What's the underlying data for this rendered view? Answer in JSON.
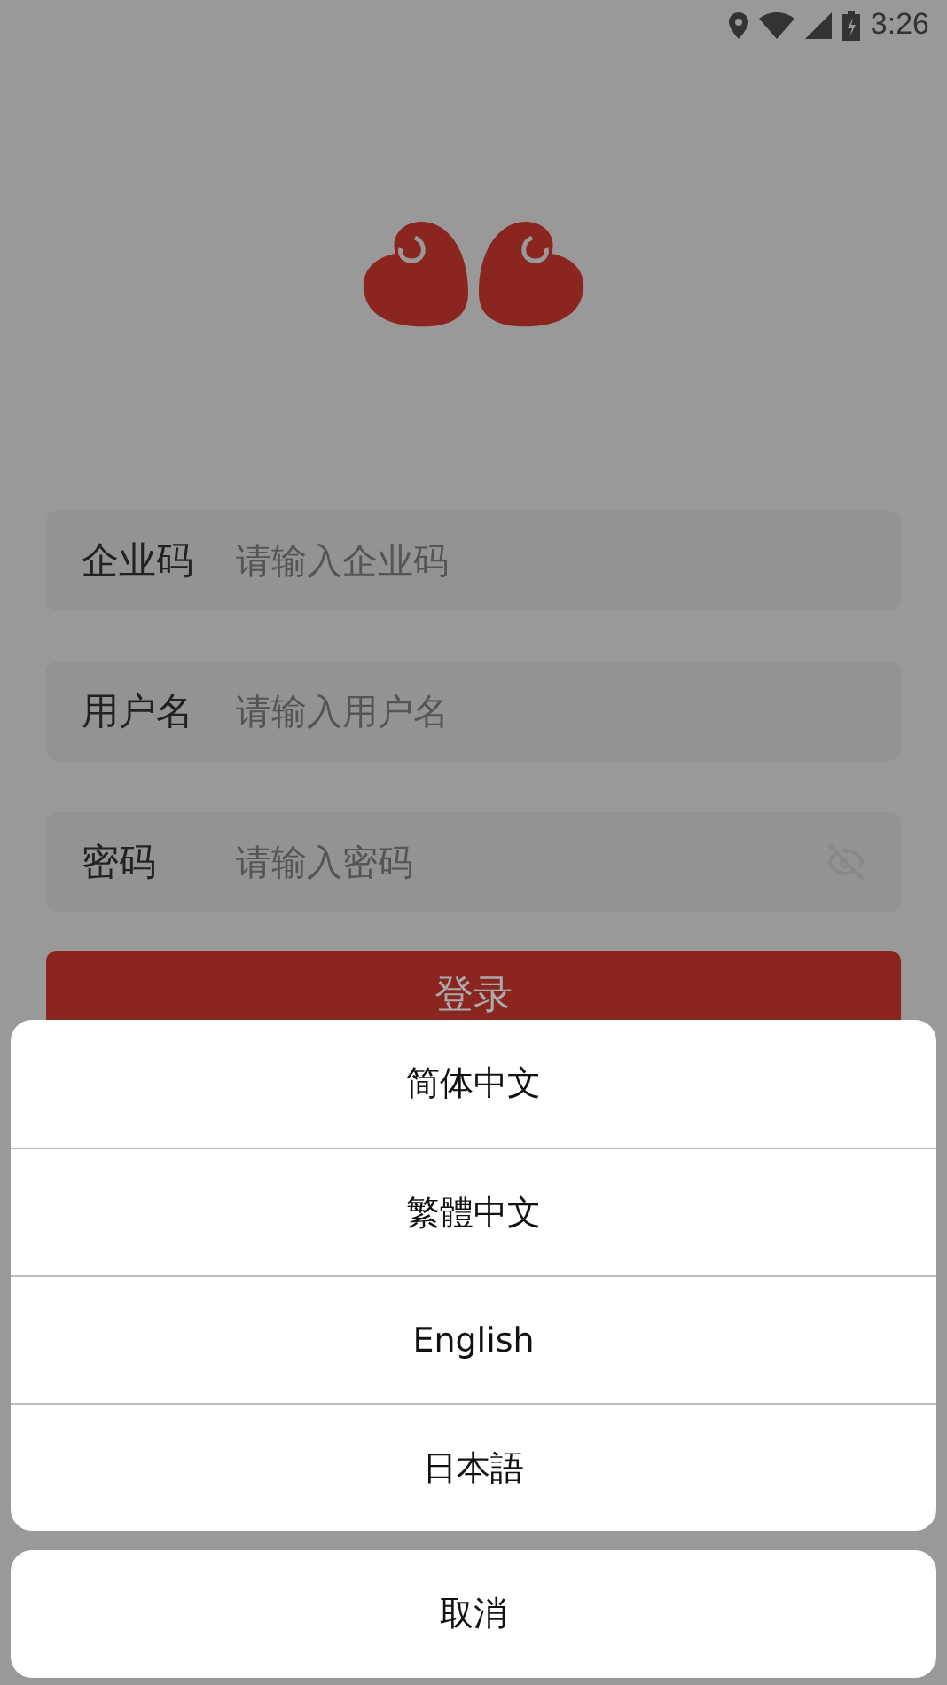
{
  "status_bar": {
    "time": "3:26"
  },
  "fields": [
    {
      "kind": "text",
      "label": "企业码",
      "placeholder": "请输入企业码"
    },
    {
      "kind": "text",
      "label": "用户名",
      "placeholder": "请输入用户名"
    },
    {
      "kind": "password",
      "label": "密码",
      "placeholder": "请输入密码"
    }
  ],
  "login_button": {
    "label": "登录"
  },
  "language_sheet": {
    "options": [
      "简体中文",
      "繁體中文",
      "English",
      "日本語"
    ],
    "cancel": "取消"
  }
}
